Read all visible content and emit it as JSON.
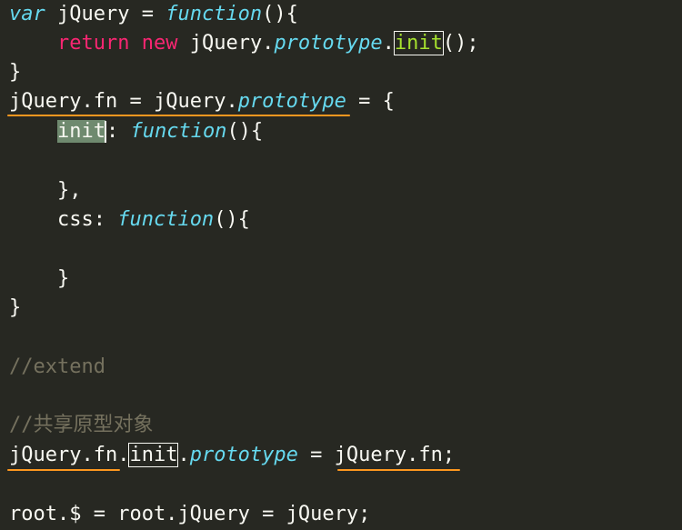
{
  "code": {
    "l1": {
      "var": "var",
      "name": " jQuery = ",
      "function": "function",
      "tail": "(){"
    },
    "l2": {
      "indent": "    ",
      "return": "return",
      "sp1": " ",
      "new": "new",
      "mid": " jQuery.",
      "prototype": "prototype",
      "dot": ".",
      "init": "init",
      "tail": "();"
    },
    "l3": {
      "text": "}"
    },
    "l4": {
      "jq_fn": "jQuery.fn",
      "eq": " = ",
      "jq": "jQuery.",
      "prototype": "prototype",
      "tail": " = {"
    },
    "l5": {
      "indent": "    ",
      "init": "init",
      "colon": ": ",
      "function": "function",
      "tail": "(){"
    },
    "l6": {
      "text": ""
    },
    "l7": {
      "text": "    },"
    },
    "l8": {
      "indent": "    ",
      "css": "css: ",
      "function": "function",
      "tail": "(){"
    },
    "l9": {
      "text": ""
    },
    "l10": {
      "text": "    }"
    },
    "l11": {
      "text": "}"
    },
    "l12": {
      "text": ""
    },
    "l13": {
      "text": "//extend"
    },
    "l14": {
      "text": ""
    },
    "l15": {
      "text": "//共享原型对象"
    },
    "l16": {
      "jq_fn": "jQuery.fn",
      "dot": ".",
      "init": "init",
      "dot2": ".",
      "prototype": "prototype",
      "eq": " = ",
      "rhs": "jQuery.fn",
      "tail": ";"
    },
    "l17": {
      "text": ""
    },
    "l18": {
      "text": "root.$ = root.jQuery = jQuery;"
    }
  },
  "colors": {
    "background": "#272822",
    "keyword_italic": "#66d9ef",
    "keyword_red": "#f92672",
    "comment": "#75715e",
    "annotation_underline": "#fd971f",
    "selection": "#6f8a6f",
    "init_highlight": "#a6e22e"
  }
}
